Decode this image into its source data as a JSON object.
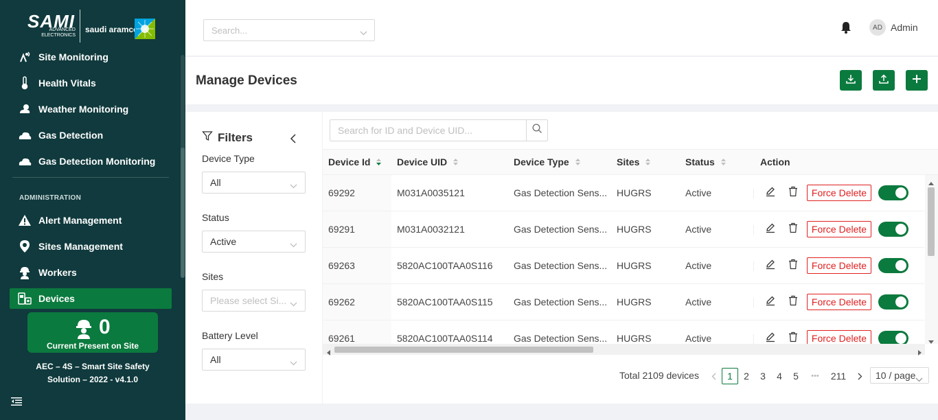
{
  "brand": {
    "logo_text": "SAMI",
    "logo_sub": "ADVANCED ELECTRONICS",
    "partner_text": "saudi aramco"
  },
  "sidebar": {
    "items": [
      {
        "label": "Site Monitoring",
        "icon": "signal-tower-icon"
      },
      {
        "label": "Health Vitals",
        "icon": "thermometer-icon"
      },
      {
        "label": "Weather Monitoring",
        "icon": "weather-icon"
      },
      {
        "label": "Gas Detection",
        "icon": "gas-cloud-icon"
      },
      {
        "label": "Gas Detection Monitoring",
        "icon": "gas-cloud-icon"
      }
    ],
    "admin_section": "ADMINISTRATION",
    "admin_items": [
      {
        "label": "Alert Management",
        "icon": "warning-icon"
      },
      {
        "label": "Sites Management",
        "icon": "location-pin-icon"
      },
      {
        "label": "Workers",
        "icon": "worker-icon"
      },
      {
        "label": "Devices",
        "icon": "devices-icon",
        "active": true
      }
    ],
    "present_count": "0",
    "present_label": "Current Present on Site",
    "footer": "AEC – 4S – Smart Site Safety Solution – 2022 - v4.1.0"
  },
  "header": {
    "search_placeholder": "Search...",
    "avatar_initials": "AD",
    "user_name": "Admin"
  },
  "page": {
    "title": "Manage Devices"
  },
  "filters": {
    "title": "Filters",
    "device_type_label": "Device Type",
    "device_type_value": "All",
    "status_label": "Status",
    "status_value": "Active",
    "sites_label": "Sites",
    "sites_placeholder": "Please select Si...",
    "battery_label": "Battery Level",
    "battery_value": "All"
  },
  "table": {
    "search_placeholder": "Search for ID and Device UID...",
    "columns": [
      "Device Id",
      "Device UID",
      "Device Type",
      "Sites",
      "Status",
      "Action"
    ],
    "force_delete_label": "Force Delete",
    "rows": [
      {
        "id": "69292",
        "uid": "M031A0035121",
        "type": "Gas Detection Sens...",
        "site": "HUGRS",
        "status": "Active",
        "enabled": true
      },
      {
        "id": "69291",
        "uid": "M031A0032121",
        "type": "Gas Detection Sens...",
        "site": "HUGRS",
        "status": "Active",
        "enabled": true
      },
      {
        "id": "69263",
        "uid": "5820AC100TAA0S116",
        "type": "Gas Detection Sens...",
        "site": "HUGRS",
        "status": "Active",
        "enabled": true
      },
      {
        "id": "69262",
        "uid": "5820AC100TAA0S115",
        "type": "Gas Detection Sens...",
        "site": "HUGRS",
        "status": "Active",
        "enabled": true
      },
      {
        "id": "69261",
        "uid": "5820AC100TAA0S114",
        "type": "Gas Detection Sens...",
        "site": "HUGRS",
        "status": "Active",
        "enabled": true
      }
    ]
  },
  "pagination": {
    "total": "Total 2109 devices",
    "pages": [
      "1",
      "2",
      "3",
      "4",
      "5"
    ],
    "ellipsis": "•••",
    "last": "211",
    "current": "1",
    "page_size": "10 / page"
  },
  "colors": {
    "sidebar_bg": "#103a3d",
    "accent_green": "#0b7a3e",
    "danger_red": "#e02020"
  }
}
